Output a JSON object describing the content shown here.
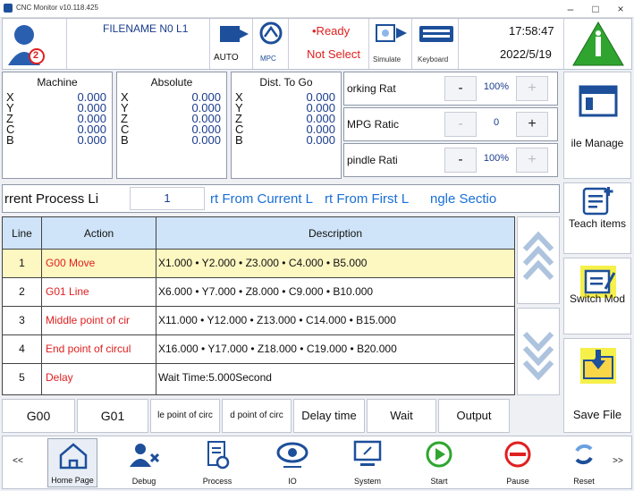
{
  "window": {
    "title": "CNC Monitor v10.118.425",
    "min": "–",
    "max": "□",
    "close": "×"
  },
  "status": {
    "badge_count": "2",
    "filename": "FILENAME N0 L1",
    "mode": "AUTO",
    "mpc": "MPC",
    "state": "•Ready",
    "select": "Not Select",
    "simulate": "Simulate",
    "keyboard": "Keyboard",
    "time": "17:58:47",
    "date": "2022/5/19"
  },
  "coords": {
    "axes": [
      "X",
      "Y",
      "Z",
      "C",
      "B"
    ],
    "machine": {
      "title": "Machine",
      "values": [
        "0.000",
        "0.000",
        "0.000",
        "0.000",
        "0.000"
      ]
    },
    "absolute": {
      "title": "Absolute",
      "values": [
        "0.000",
        "0.000",
        "0.000",
        "0.000",
        "0.000"
      ]
    },
    "dist": {
      "title": "Dist. To Go",
      "values": [
        "0.000",
        "0.000",
        "0.000",
        "0.000",
        "0.000"
      ]
    }
  },
  "ratios": [
    {
      "label": "orking Rat",
      "minus": "-",
      "value": "100%",
      "plus": "+"
    },
    {
      "label": "MPG Ratic",
      "minus": "-",
      "value": "0",
      "plus": "+"
    },
    {
      "label": "pindle Rati",
      "minus": "-",
      "value": "100%",
      "plus": "+"
    }
  ],
  "side": {
    "file_manage": "ile Manage",
    "teach": "Teach items",
    "switch": "Switch Mod",
    "save": "Save File"
  },
  "process": {
    "label": "rrent Process Li",
    "line": "1",
    "from_current": "rt From Current L",
    "from_first": "rt From First L",
    "single": "ngle Sectio"
  },
  "table": {
    "headers": [
      "Line No.",
      "Action",
      "Description"
    ],
    "rows": [
      {
        "no": "1",
        "action": "G00 Move",
        "desc": "X1.000 • Y2.000 • Z3.000 • C4.000 • B5.000"
      },
      {
        "no": "2",
        "action": "G01 Line",
        "desc": "X6.000 • Y7.000 • Z8.000 • C9.000 • B10.000"
      },
      {
        "no": "3",
        "action": "Middle point of cir",
        "desc": "X11.000 • Y12.000 • Z13.000 • C14.000 • B15.000"
      },
      {
        "no": "4",
        "action": "End point of circul",
        "desc": "X16.000 • Y17.000 • Z18.000 • C19.000 • B20.000"
      },
      {
        "no": "5",
        "action": "Delay",
        "desc": "Wait Time:5.000Second"
      }
    ]
  },
  "funcs": [
    "G00",
    "G01",
    "le point of circ",
    "d point of circ",
    "Delay time",
    "Wait",
    "Output"
  ],
  "nav": {
    "prev": "<<",
    "home": "Home Page",
    "debug": "Debug",
    "process": "Process",
    "io": "IO",
    "system": "System",
    "start": "Start",
    "pause": "Pause",
    "reset": "Reset",
    "next": ">>"
  },
  "colors": {
    "accent_red": "#e02020",
    "value_blue": "#1a3c8c",
    "selected_row": "#fdf7c2",
    "header_blue": "#cfe4f8",
    "alarm_green": "#2fa52f"
  }
}
